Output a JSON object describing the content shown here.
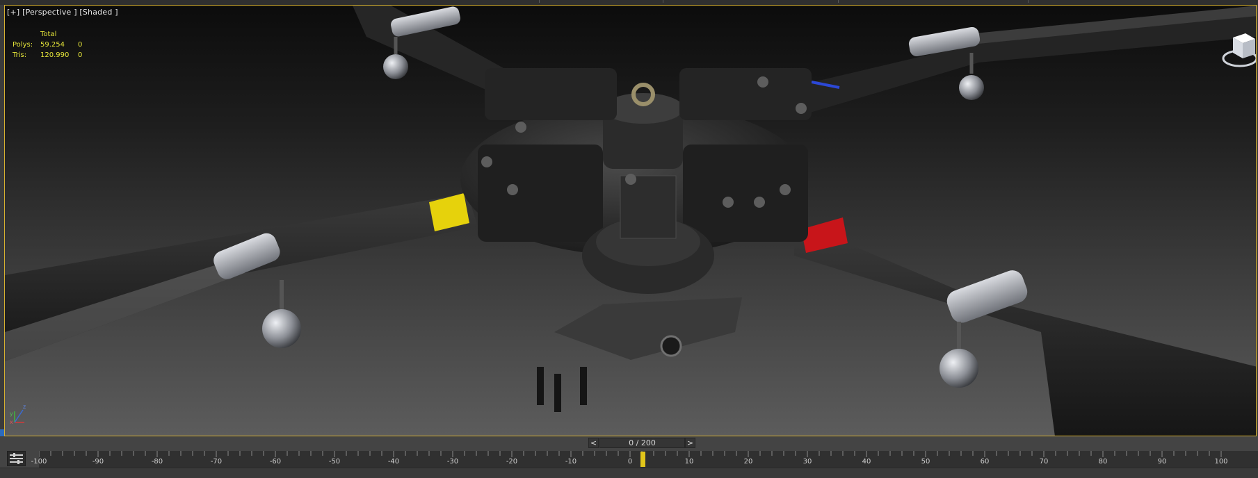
{
  "viewport": {
    "label": "[+] [Perspective ] [Shaded ]",
    "stats": {
      "header": "Total",
      "rows": [
        {
          "name": "Polys:",
          "total": "59.254",
          "selected": "0"
        },
        {
          "name": "Tris:",
          "total": "120.990",
          "selected": "0"
        }
      ]
    },
    "axis": {
      "x": "x",
      "y": "y",
      "z": "z"
    },
    "viewcube_icon": "viewcube-icon",
    "object_colors": {
      "yellow_band": "#e6d20c",
      "red_band": "#c8151a",
      "blue_band": "#2c48d6",
      "green_band": "#2fae2f"
    }
  },
  "timeline": {
    "prev_label": "<",
    "slider_label": "0 / 200",
    "next_label": ">",
    "ruler_labels": [
      "-100",
      "-90",
      "-80",
      "-70",
      "-60",
      "-50",
      "-40",
      "-30",
      "-20",
      "-10",
      "0",
      "10",
      "20",
      "30",
      "40",
      "50",
      "60",
      "70",
      "80",
      "90",
      "100"
    ],
    "current_frame": 0,
    "total_frames": 200,
    "playhead_color": "#e2c61a",
    "track_icon": "track-view-icon"
  }
}
